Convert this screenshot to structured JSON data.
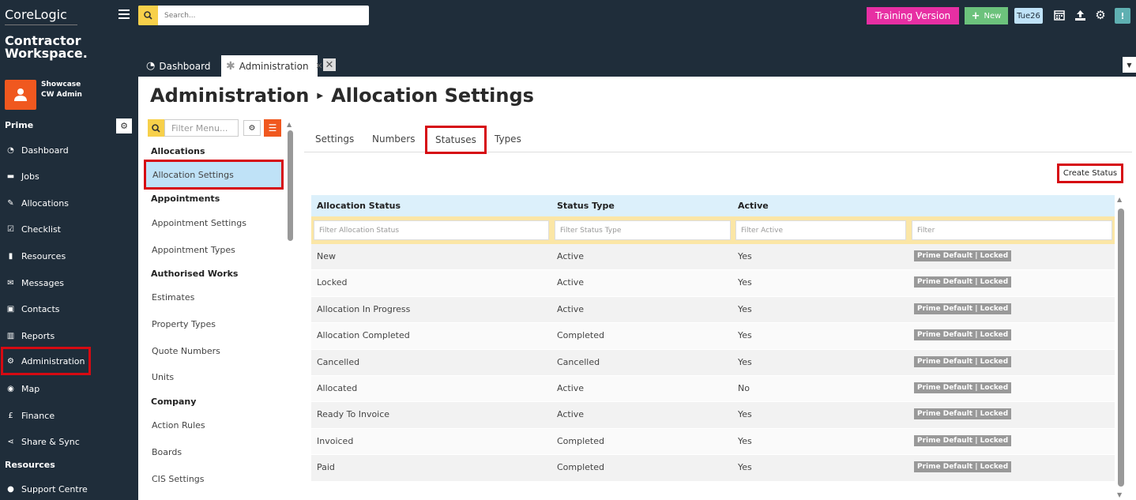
{
  "brand": {
    "line1": "CoreLogic",
    "line2": "Contractor",
    "line3": "Workspace."
  },
  "user": {
    "name": "Showcase",
    "role": "CW Admin"
  },
  "header": {
    "search_placeholder": "Search...",
    "training_label": "Training Version",
    "new_label": "New",
    "date_label": "Tue26"
  },
  "tabs": {
    "dashboard": "Dashboard",
    "administration": "Administration"
  },
  "sidebar": {
    "section_prime": "Prime",
    "section_resources": "Resources",
    "items": [
      {
        "label": "Dashboard",
        "icon": "gauge-icon",
        "glyph": "◔"
      },
      {
        "label": "Jobs",
        "icon": "folder-icon",
        "glyph": "▬"
      },
      {
        "label": "Allocations",
        "icon": "wrench-icon",
        "glyph": "✎"
      },
      {
        "label": "Checklist",
        "icon": "checkbox-icon",
        "glyph": "☑"
      },
      {
        "label": "Resources",
        "icon": "clipboard-icon",
        "glyph": "▮"
      },
      {
        "label": "Messages",
        "icon": "envelope-icon",
        "glyph": "✉"
      },
      {
        "label": "Contacts",
        "icon": "address-book-icon",
        "glyph": "▣"
      },
      {
        "label": "Reports",
        "icon": "chart-icon",
        "glyph": "▥"
      },
      {
        "label": "Administration",
        "icon": "gear-icon",
        "glyph": "⚙"
      },
      {
        "label": "Map",
        "icon": "globe-icon",
        "glyph": "◉"
      },
      {
        "label": "Finance",
        "icon": "pound-icon",
        "glyph": "£"
      },
      {
        "label": "Share & Sync",
        "icon": "share-icon",
        "glyph": "⋖"
      }
    ],
    "support": {
      "label": "Support Centre",
      "icon": "info-icon",
      "glyph": "●"
    }
  },
  "page": {
    "title_part1": "Administration",
    "title_part2": "Allocation Settings"
  },
  "admin_menu": {
    "filter_placeholder": "Filter Menu...",
    "groups": {
      "allocations": "Allocations",
      "appointments": "Appointments",
      "authorised_works": "Authorised Works",
      "company": "Company"
    },
    "items": {
      "allocation_settings": "Allocation Settings",
      "appointment_settings": "Appointment Settings",
      "appointment_types": "Appointment Types",
      "estimates": "Estimates",
      "property_types": "Property Types",
      "quote_numbers": "Quote Numbers",
      "units": "Units",
      "action_rules": "Action Rules",
      "boards": "Boards",
      "cis_settings": "CIS Settings"
    }
  },
  "content_tabs": {
    "settings": "Settings",
    "numbers": "Numbers",
    "statuses": "Statuses",
    "types": "Types"
  },
  "create_status_label": "Create Status",
  "table": {
    "headers": {
      "status": "Allocation Status",
      "type": "Status Type",
      "active": "Active"
    },
    "filters": {
      "status": "Filter Allocation Status",
      "type": "Filter Status Type",
      "active": "Filter Active",
      "other": "Filter"
    },
    "rows": [
      {
        "status": "New",
        "type": "Active",
        "active": "Yes",
        "badge": "Prime Default | Locked"
      },
      {
        "status": "Locked",
        "type": "Active",
        "active": "Yes",
        "badge": "Prime Default | Locked"
      },
      {
        "status": "Allocation In Progress",
        "type": "Active",
        "active": "Yes",
        "badge": "Prime Default | Locked"
      },
      {
        "status": "Allocation Completed",
        "type": "Completed",
        "active": "Yes",
        "badge": "Prime Default | Locked"
      },
      {
        "status": "Cancelled",
        "type": "Cancelled",
        "active": "Yes",
        "badge": "Prime Default | Locked"
      },
      {
        "status": "Allocated",
        "type": "Active",
        "active": "No",
        "badge": "Prime Default | Locked"
      },
      {
        "status": "Ready To Invoice",
        "type": "Active",
        "active": "Yes",
        "badge": "Prime Default | Locked"
      },
      {
        "status": "Invoiced",
        "type": "Completed",
        "active": "Yes",
        "badge": "Prime Default | Locked"
      },
      {
        "status": "Paid",
        "type": "Completed",
        "active": "Yes",
        "badge": "Prime Default | Locked"
      }
    ]
  },
  "colors": {
    "header_bg": "#1f2d3a",
    "accent_orange": "#f0581f",
    "training_pink": "#e72fa3",
    "new_green": "#6cc27c",
    "highlight_red": "#d60a12",
    "search_yellow": "#f7d04a",
    "table_head_blue": "#dcf0fb"
  }
}
